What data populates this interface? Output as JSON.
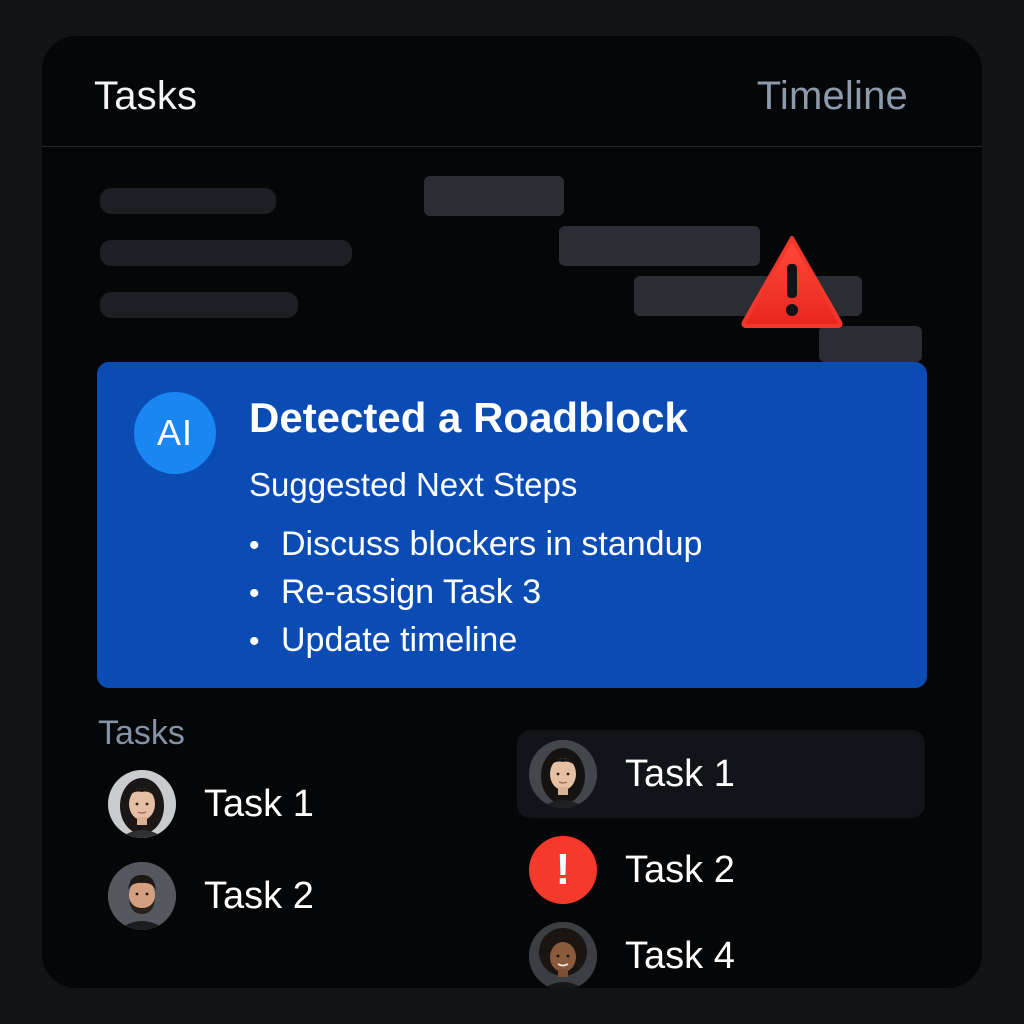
{
  "header": {
    "tabs": [
      {
        "label": "Tasks"
      },
      {
        "label": "Timeline"
      }
    ]
  },
  "ai_panel": {
    "badge": "AI",
    "title": "Detected a Roadblock",
    "subtitle": "Suggested Next Steps",
    "steps": [
      "Discuss blockers in standup",
      "Re-assign Task 3",
      "Update timeline"
    ],
    "bullet": "•",
    "color": "#0a4cb4"
  },
  "tasks_list": {
    "heading": "Tasks",
    "items": [
      {
        "label": "Task 1",
        "icon": "woman-avatar"
      },
      {
        "label": "Task 2",
        "icon": "man-avatar"
      }
    ]
  },
  "timeline_list": {
    "items": [
      {
        "label": "Task 1",
        "icon": "woman-avatar"
      },
      {
        "label": "Task 2",
        "icon": "alert-icon"
      },
      {
        "label": "Task 4",
        "icon": "woman-avatar"
      }
    ]
  },
  "colors": {
    "accent": "#0a4cb4",
    "warning": "#f53a2b",
    "background": "#050607"
  }
}
